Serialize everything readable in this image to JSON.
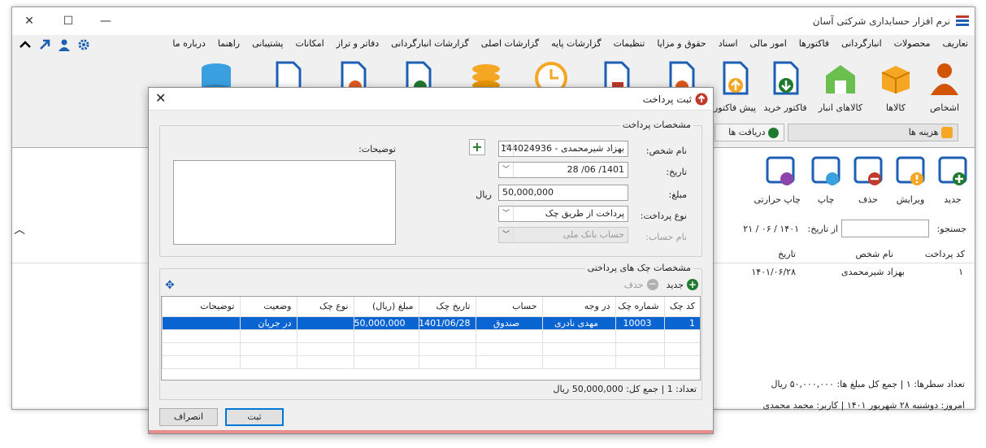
{
  "app": {
    "title": "نرم افزار حسابداری شرکتی آسان"
  },
  "menu": [
    "تعاریف",
    "محصولات",
    "انبارگردانی",
    "فاکتورها",
    "امور مالی",
    "اسناد",
    "حقوق و مزایا",
    "تنظیمات",
    "گزارشات پایه",
    "گزارشات اصلی",
    "گزارشات انبارگردانی",
    "دفاتر و تراز",
    "امکانات",
    "پشتیبانی",
    "راهنما",
    "درباره ما"
  ],
  "ribbon": [
    {
      "label": "اشخاص",
      "icon": "person-icon"
    },
    {
      "label": "کالاها",
      "icon": "box-icon"
    },
    {
      "label": "کالاهای انبار",
      "icon": "warehouse-icon"
    },
    {
      "label": "فاکتور خرید",
      "icon": "purchase-invoice-icon"
    },
    {
      "label": "پیش فاکتور",
      "icon": "proforma-icon"
    }
  ],
  "tabs": {
    "expenses": "هزینه ها",
    "receipts": "دریافت ها"
  },
  "subtoolbar": [
    {
      "label": "جدید",
      "icon": "new-folder-icon"
    },
    {
      "label": "ویرایش",
      "icon": "edit-folder-icon"
    },
    {
      "label": "حذف",
      "icon": "delete-folder-icon"
    },
    {
      "label": "چاپ",
      "icon": "print-folder-icon"
    },
    {
      "label": "چاپ حرارتی",
      "icon": "thermal-print-icon"
    },
    {
      "label": "چاپ",
      "icon": "print-icon"
    }
  ],
  "search": {
    "label": "جستجو:",
    "from_label": "از تاریخ:",
    "from_value": "۱۴۰۱ / ۰۶ / ۲۱"
  },
  "list": {
    "headers": [
      "کد پرداخت",
      "نام شخص",
      "تاریخ"
    ],
    "row": {
      "code": "۱",
      "name": "بهزاد شیرمحمدی",
      "date": "۱۴۰۱/۰۶/۲۸"
    }
  },
  "status": {
    "rows": "تعداد سطرها:  ۱   |  جمع کل مبلغ ها: ۵۰,۰۰۰,۰۰۰ ریال",
    "today": "امروز: دوشنبه ۲۸ شهریور ۱۴۰۱   |   کاربر: محمد محمدی"
  },
  "dialog": {
    "title": "ثبت پرداخت",
    "payment_group": "مشخصات پرداخت",
    "person_label": "نام شخص:",
    "person_value": "بهزاد شیرمحمدی - 144024936",
    "date_label": "تاریخ:",
    "date_value": "1401/ 06/ 28",
    "amount_label": "مبلغ:",
    "amount_value": "50,000,000",
    "amount_unit": "ریال",
    "type_label": "نوع پرداخت:",
    "type_value": "پرداخت از طریق چک",
    "account_label": "نام حساب:",
    "account_value": "حساب بانک ملی",
    "desc_label": "توضیحات:",
    "cheque_group": "مشخصات چک های پرداختی",
    "add_label": "جدید",
    "delete_label": "حذف",
    "cheque_headers": [
      "کد چک",
      "شماره چک",
      "در وجه",
      "حساب",
      "تاریخ چک",
      "مبلغ (ریال)",
      "نوع چک",
      "وضعیت",
      "توضیحات"
    ],
    "cheque_row": [
      "1",
      "10003",
      "مهدی نادری",
      "صندوق",
      "1401/06/28",
      "50,000,000",
      "",
      "در جریان",
      ""
    ],
    "count_text": "تعداد:  1   |   جمع کل: 50,000,000  ریال",
    "save_label": "ثبت",
    "cancel_label": "انصراف"
  }
}
